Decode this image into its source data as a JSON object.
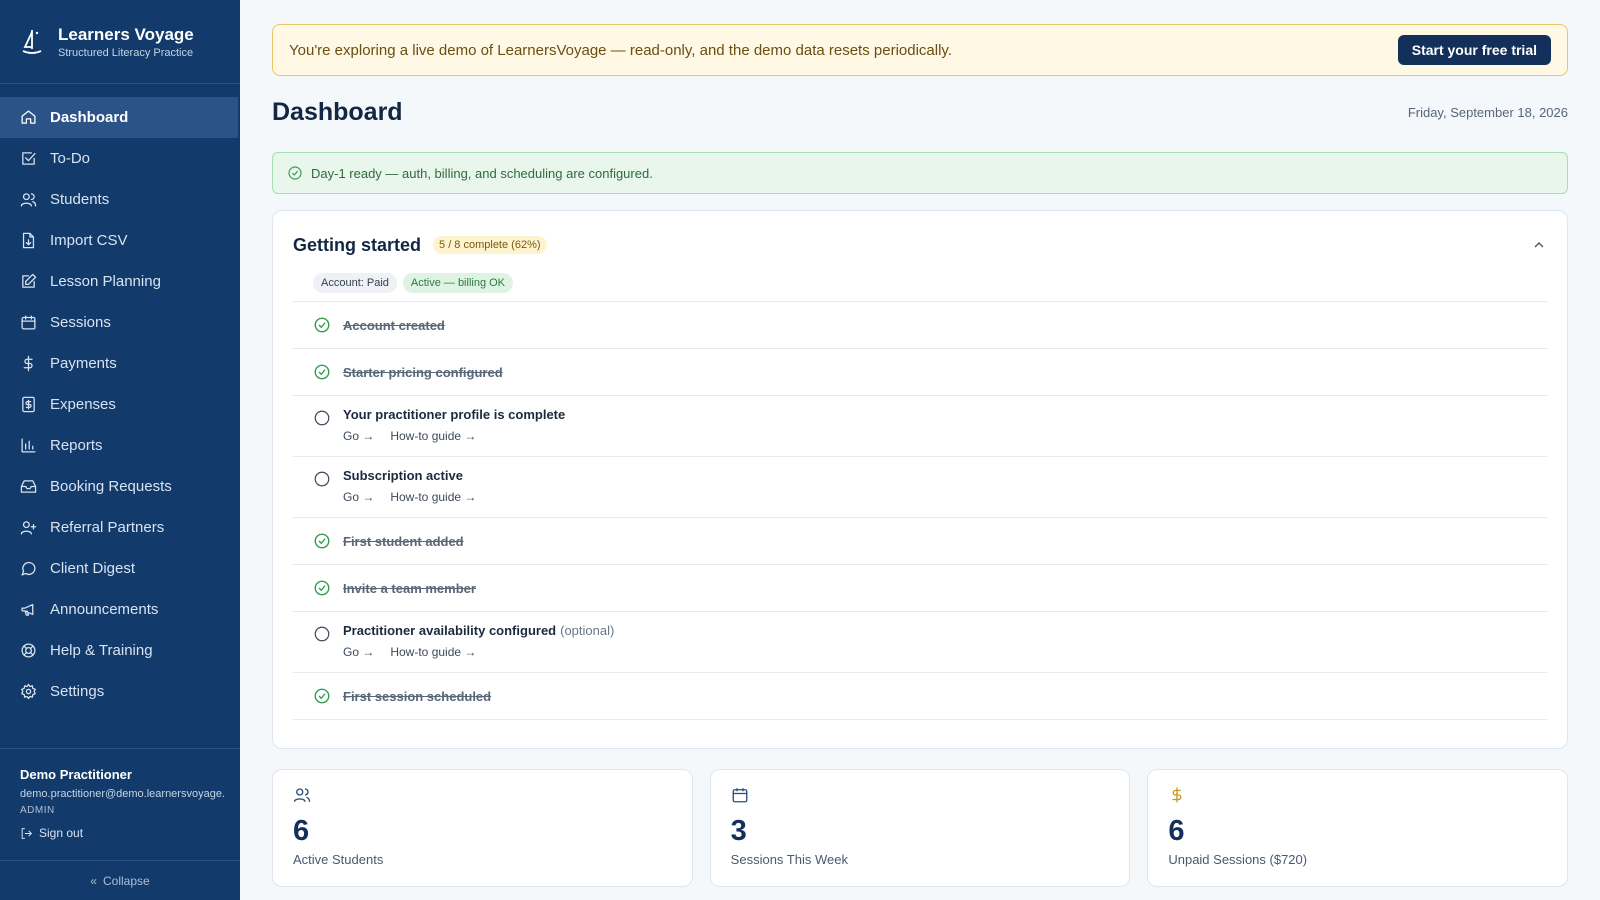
{
  "brand": {
    "name": "Learners Voyage",
    "subtitle": "Structured Literacy Practice"
  },
  "sidebar": {
    "items": [
      {
        "label": "Dashboard",
        "icon": "home-icon",
        "active": true
      },
      {
        "label": "To-Do",
        "icon": "checkbox-icon"
      },
      {
        "label": "Students",
        "icon": "users-icon"
      },
      {
        "label": "Import CSV",
        "icon": "file-import-icon"
      },
      {
        "label": "Lesson Planning",
        "icon": "edit-icon"
      },
      {
        "label": "Sessions",
        "icon": "calendar-icon"
      },
      {
        "label": "Payments",
        "icon": "dollar-icon"
      },
      {
        "label": "Expenses",
        "icon": "receipt-icon"
      },
      {
        "label": "Reports",
        "icon": "bar-chart-icon"
      },
      {
        "label": "Booking Requests",
        "icon": "inbox-icon"
      },
      {
        "label": "Referral Partners",
        "icon": "user-plus-icon"
      },
      {
        "label": "Client Digest",
        "icon": "message-icon"
      },
      {
        "label": "Announcements",
        "icon": "megaphone-icon"
      },
      {
        "label": "Help & Training",
        "icon": "lifebuoy-icon"
      },
      {
        "label": "Settings",
        "icon": "gear-icon"
      }
    ],
    "user": {
      "name": "Demo Practitioner",
      "email": "demo.practitioner@demo.learnersvoyage.",
      "role": "ADMIN",
      "signout": "Sign out"
    },
    "collapse": "Collapse"
  },
  "demo_banner": {
    "text": "You're exploring a live demo of LearnersVoyage — read-only, and the demo data resets periodically.",
    "button": "Start your free trial"
  },
  "header": {
    "title": "Dashboard",
    "date": "Friday, September 18, 2026"
  },
  "ready_banner": "Day-1 ready — auth, billing, and scheduling are configured.",
  "getting_started": {
    "title": "Getting started",
    "progress": "5 / 8 complete (62%)",
    "pills": {
      "account": "Account: Paid",
      "billing": "Active — billing OK"
    },
    "tasks": [
      {
        "label": "Account created",
        "done": true
      },
      {
        "label": "Starter pricing configured",
        "done": true
      },
      {
        "label": "Your practitioner profile is complete",
        "done": false,
        "go": "Go →",
        "guide": "How-to guide →"
      },
      {
        "label": "Subscription active",
        "done": false,
        "go": "Go →",
        "guide": "How-to guide →"
      },
      {
        "label": "First student added",
        "done": true
      },
      {
        "label": "Invite a team member",
        "done": true
      },
      {
        "label": "Practitioner availability configured",
        "optional": "(optional)",
        "done": false,
        "go": "Go →",
        "guide": "How-to guide →"
      },
      {
        "label": "First session scheduled",
        "done": true
      }
    ]
  },
  "stats": [
    {
      "value": "6",
      "label": "Active Students",
      "icon": "users-icon"
    },
    {
      "value": "3",
      "label": "Sessions This Week",
      "icon": "calendar-icon"
    },
    {
      "value": "6",
      "label": "Unpaid Sessions ($720)",
      "icon": "dollar-icon"
    }
  ],
  "colors": {
    "sidebar": "#123a6b",
    "accent": "#12305a",
    "success": "#2f9a4c",
    "warning_bg": "#fef8e4"
  }
}
